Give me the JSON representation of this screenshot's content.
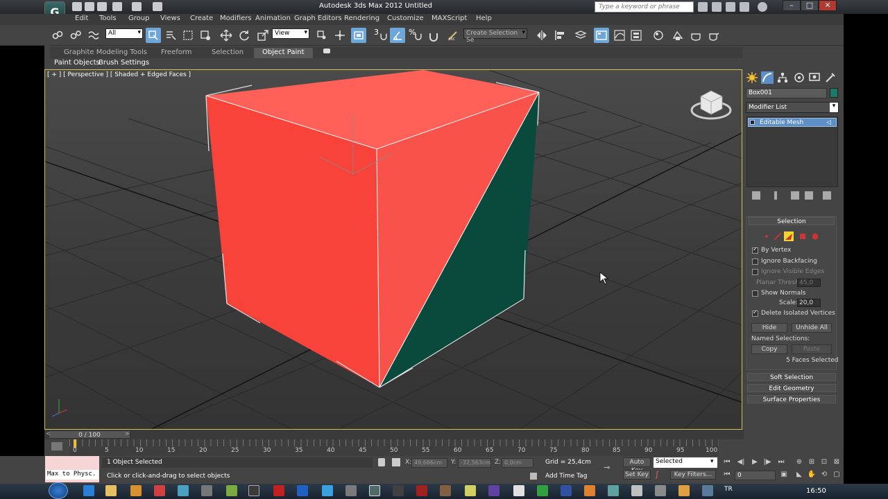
{
  "window": {
    "title": "Autodesk 3ds Max  2012     Untitled",
    "search_placeholder": "Type a keyword or phrase",
    "min": "–",
    "max": "□",
    "close": "✕"
  },
  "menu": [
    "Edit",
    "Tools",
    "Group",
    "Views",
    "Create",
    "Modifiers",
    "Animation",
    "Graph Editors",
    "Rendering",
    "Customize",
    "MAXScript",
    "Help"
  ],
  "toolbar": {
    "selection_filter": "All",
    "ref_coord": "View",
    "named_sel": "Create Selection Se",
    "snap_3": "3",
    "snap_pct": "%"
  },
  "ribbon": {
    "tabs": [
      "Graphite Modeling Tools",
      "Freeform",
      "Selection",
      "Object Paint"
    ],
    "active_tab": "Object Paint",
    "items": [
      "Paint Objects",
      "Brush Settings"
    ]
  },
  "viewport": {
    "label": "[ + ] [ Perspective ] [ Shaded + Edged Faces ]"
  },
  "command_panel": {
    "object_name": "Box001",
    "object_color": "#1d7a68",
    "modifier_list": "Modifier List",
    "stack_item": "Editable Mesh",
    "rollout_selection": "Selection",
    "by_vertex": "By Vertex",
    "ignore_backfacing": "Ignore Backfacing",
    "ignore_visible_edges": "Ignore Visible Edges",
    "planar_thresh_label": "Planar Thresh:",
    "planar_thresh_value": "45,0",
    "show_normals": "Show Normals",
    "scale_label": "Scale:",
    "scale_value": "20,0",
    "delete_isolated": "Delete Isolated Vertices",
    "hide": "Hide",
    "unhide_all": "Unhide All",
    "named_selections": "Named Selections:",
    "copy": "Copy",
    "paste": "Paste",
    "faces_selected": "5 Faces Selected",
    "rollouts": [
      "Soft Selection",
      "Edit Geometry",
      "Surface Properties"
    ]
  },
  "timeline": {
    "slider": "0 / 100",
    "ticks": [
      "0",
      "5",
      "10",
      "15",
      "20",
      "25",
      "30",
      "35",
      "40",
      "45",
      "50",
      "55",
      "60",
      "65",
      "70",
      "75",
      "80",
      "85",
      "90",
      "95",
      "100"
    ]
  },
  "status": {
    "maxscript": "Max to Physc.",
    "selected": "1 Object Selected",
    "prompt": "Click or click-and-drag to select objects",
    "x_label": "X:",
    "x_value": "49,666cm",
    "y_label": "Y:",
    "y_value": "-32,563cm",
    "z_label": "Z:",
    "z_value": "0,0cm",
    "grid": "Grid = 25,4cm",
    "add_time_tag": "Add Time Tag",
    "auto_key": "Auto Key",
    "set_key": "Set Key",
    "key_mode": "Selected",
    "key_filters": "Key Filters...",
    "frame": "0"
  },
  "taskbar": {
    "lang": "TR",
    "clock": "16:50"
  }
}
